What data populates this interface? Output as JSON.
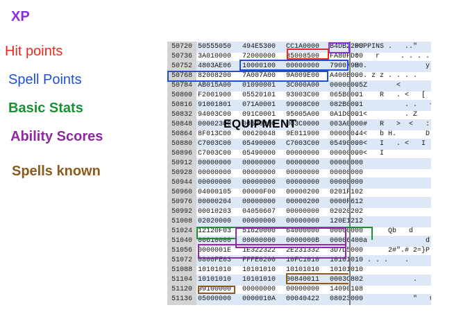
{
  "legend": {
    "xp": {
      "label": "XP",
      "color": "#8b2be2"
    },
    "hit_points": {
      "label": "Hit points",
      "color": "#e8291c"
    },
    "spell_points": {
      "label": "Spell Points",
      "color": "#1f4fd8"
    },
    "basic_stats": {
      "label": "Basic Stats",
      "color": "#1a8f33"
    },
    "ability_scores": {
      "label": "Ability Scores",
      "color": "#8e2aa0"
    },
    "spells_known": {
      "label": "Spells known",
      "color": "#8b5a1e"
    }
  },
  "equipment_label": "EQUIPMENT",
  "rows": [
    {
      "offset": "50720",
      "hex": [
        "50555050",
        "494E5300",
        "CC1A0000",
        "B4DB2200"
      ],
      "ascii": "PUPPINS .   ..\""
    },
    {
      "offset": "50736",
      "hex": [
        "3A010000",
        "72000000",
        "85008500",
        "FA80FD00"
      ],
      "ascii": ":    r     . . . ."
    },
    {
      "offset": "50752",
      "hex": [
        "4803AE06",
        "10000100",
        "00000000",
        "79007900"
      ],
      "ascii": "H .              y y"
    },
    {
      "offset": "50768",
      "hex": [
        "82008200",
        "7A007A00",
        "9A009E00",
        "A400B000"
      ],
      "ascii": ". . z z . . . ."
    },
    {
      "offset": "50784",
      "hex": [
        "AB015A00",
        "01090001",
        "3C000A00",
        "00000005"
      ],
      "ascii": ". Z       <"
    },
    {
      "offset": "50800",
      "hex": [
        "F2001900",
        "05520101",
        "93003C00",
        "065B0001"
      ],
      "ascii": ".     R   . <   ["
    },
    {
      "offset": "50816",
      "hex": [
        "91001801",
        "071A0001",
        "99008C00",
        "082B0001"
      ],
      "ascii": ".           . .   +"
    },
    {
      "offset": "50832",
      "hex": [
        "94003C00",
        "091C0001",
        "95005A00",
        "0A1D0001"
      ],
      "ascii": ". <         . Z"
    },
    {
      "offset": "50848",
      "hex": [
        "00002300",
        "00520000",
        "003C0000",
        "003A0000"
      ],
      "ascii": "  #   R   >  <   :"
    },
    {
      "offset": "50864",
      "hex": [
        "8F013C00",
        "00620048",
        "9E011900",
        "00000044"
      ],
      "ascii": ". <   b H.       D"
    },
    {
      "offset": "50880",
      "hex": [
        "C7003C00",
        "05490000",
        "C7003C00",
        "05490000"
      ],
      "ascii": ". <   I   . <   I"
    },
    {
      "offset": "50896",
      "hex": [
        "C7003C00",
        "05490000",
        "00000000",
        "00000000"
      ],
      "ascii": ". <   I"
    },
    {
      "offset": "50912",
      "hex": [
        "00000000",
        "00000000",
        "00000000",
        "00000000"
      ],
      "ascii": ""
    },
    {
      "offset": "50928",
      "hex": [
        "00000000",
        "00000000",
        "00000000",
        "00000000"
      ],
      "ascii": ""
    },
    {
      "offset": "50944",
      "hex": [
        "00000000",
        "00000000",
        "00000000",
        "00000000"
      ],
      "ascii": ""
    },
    {
      "offset": "50960",
      "hex": [
        "04000105",
        "00000F00",
        "00000200",
        "0201F102"
      ],
      "ascii": "                    ."
    },
    {
      "offset": "50976",
      "hex": [
        "00000204",
        "00000000",
        "00000200",
        "0000F612"
      ],
      "ascii": "                    ."
    },
    {
      "offset": "50992",
      "hex": [
        "00010203",
        "04050607",
        "00000000",
        "02020202"
      ],
      "ascii": ""
    },
    {
      "offset": "51008",
      "hex": [
        "02020000",
        "00000000",
        "00000000",
        "120E1212"
      ],
      "ascii": ""
    },
    {
      "offset": "51024",
      "hex": [
        "12120F03",
        "51620000",
        "64000000",
        "00000000"
      ],
      "ascii": "        Qb   d"
    },
    {
      "offset": "51040",
      "hex": [
        "00610000",
        "00000000",
        "0000000B",
        "00006400"
      ],
      "ascii": "  a              d"
    },
    {
      "offset": "51056",
      "hex": [
        "0000001E",
        "1E322322",
        "2E231332",
        "3D7D5000"
      ],
      "ascii": "        2#\".# 2=}P"
    },
    {
      "offset": "51072",
      "hex": [
        "0800FE03",
        "FFFE0200",
        "10FC1010",
        "10101010"
      ],
      "ascii": "   . . .    ."
    },
    {
      "offset": "51088",
      "hex": [
        "10101010",
        "10101010",
        "10101010",
        "10101010"
      ],
      "ascii": ""
    },
    {
      "offset": "51104",
      "hex": [
        "10101010",
        "10101010",
        "00840011",
        "0003C802"
      ],
      "ascii": "              .    ."
    },
    {
      "offset": "51120",
      "hex": [
        "99100000",
        "00000000",
        "00000000",
        "14090108"
      ],
      "ascii": "."
    },
    {
      "offset": "51136",
      "hex": [
        "05000000",
        "0000010A",
        "00040422",
        "08023000"
      ],
      "ascii": "              \"   0"
    }
  ]
}
